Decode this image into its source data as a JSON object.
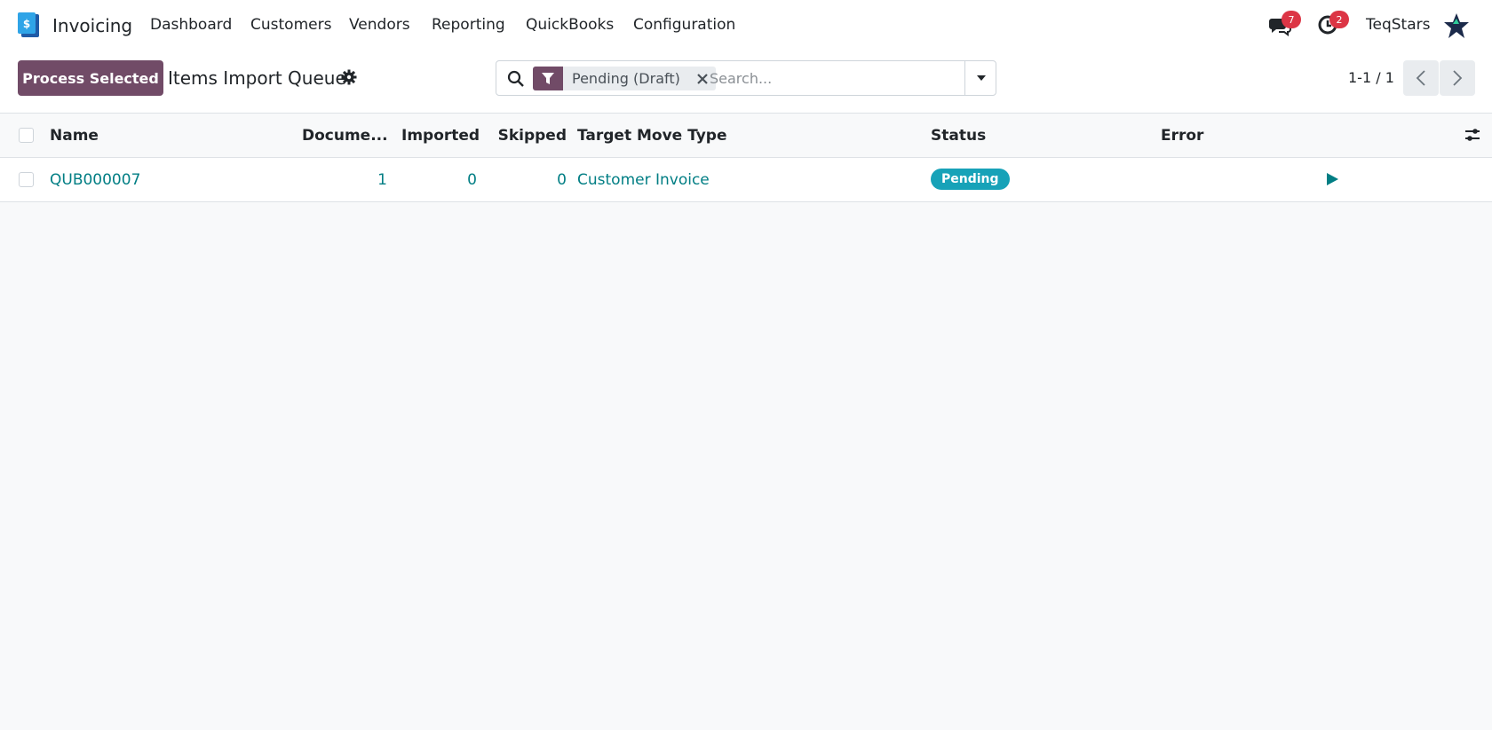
{
  "navbar": {
    "app_name": "Invoicing",
    "menu": [
      "Dashboard",
      "Customers",
      "Vendors",
      "Reporting",
      "QuickBooks",
      "Configuration"
    ],
    "messages_count": "7",
    "activities_count": "2",
    "company": "TeqStars"
  },
  "control_panel": {
    "process_button": "Process Selected",
    "title": "Items Import Queue",
    "search": {
      "facet": "Pending (Draft)",
      "placeholder": "Search..."
    },
    "pager": "1-1 / 1"
  },
  "list": {
    "columns": {
      "name": "Name",
      "documents": "Docume...",
      "imported": "Imported",
      "skipped": "Skipped",
      "target_move_type": "Target Move Type",
      "status": "Status",
      "error": "Error"
    },
    "rows": [
      {
        "name": "QUB000007",
        "documents": "1",
        "imported": "0",
        "skipped": "0",
        "target_move_type": "Customer Invoice",
        "status": "Pending",
        "error": ""
      }
    ]
  },
  "colors": {
    "primary": "#714b67",
    "link": "#017e84",
    "status_pending": "#17a2b8",
    "badge": "#dc3545"
  }
}
